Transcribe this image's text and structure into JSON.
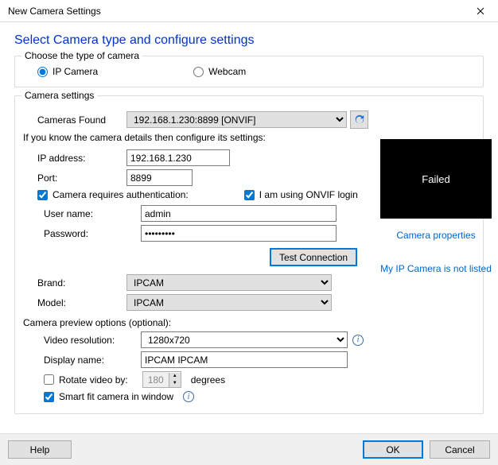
{
  "window": {
    "title": "New Camera Settings"
  },
  "heading": "Select Camera type and configure settings",
  "typeGroup": {
    "legend": "Choose the type of camera",
    "ip": "IP Camera",
    "webcam": "Webcam"
  },
  "settings": {
    "legend": "Camera settings",
    "camerasFoundLabel": "Cameras Found",
    "camerasFoundValue": "192.168.1.230:8899 [ONVIF]",
    "hint": "If you know the camera details then configure its settings:",
    "ipLabel": "IP address:",
    "ipValue": "192.168.1.230",
    "portLabel": "Port:",
    "portValue": "8899",
    "authLabel": "Camera requires authentication:",
    "onvifLabel": "I am using ONVIF login",
    "userLabel": "User name:",
    "userValue": "admin",
    "passLabel": "Password:",
    "passValue": "•••••••••",
    "testBtn": "Test Connection",
    "brandLabel": "Brand:",
    "brandValue": "IPCAM",
    "modelLabel": "Model:",
    "modelValue": "IPCAM",
    "previewHead": "Camera preview options (optional):",
    "resLabel": "Video resolution:",
    "resValue": "1280x720",
    "dispLabel": "Display name:",
    "dispValue": "IPCAM IPCAM",
    "rotateLabel": "Rotate video by:",
    "rotateValue": "180",
    "rotateSuffix": "degrees",
    "smartFitLabel": "Smart fit camera in window",
    "previewStatus": "Failed",
    "propsLink": "Camera properties",
    "notListedLink": "My IP Camera is not listed"
  },
  "footer": {
    "help": "Help",
    "ok": "OK",
    "cancel": "Cancel"
  }
}
